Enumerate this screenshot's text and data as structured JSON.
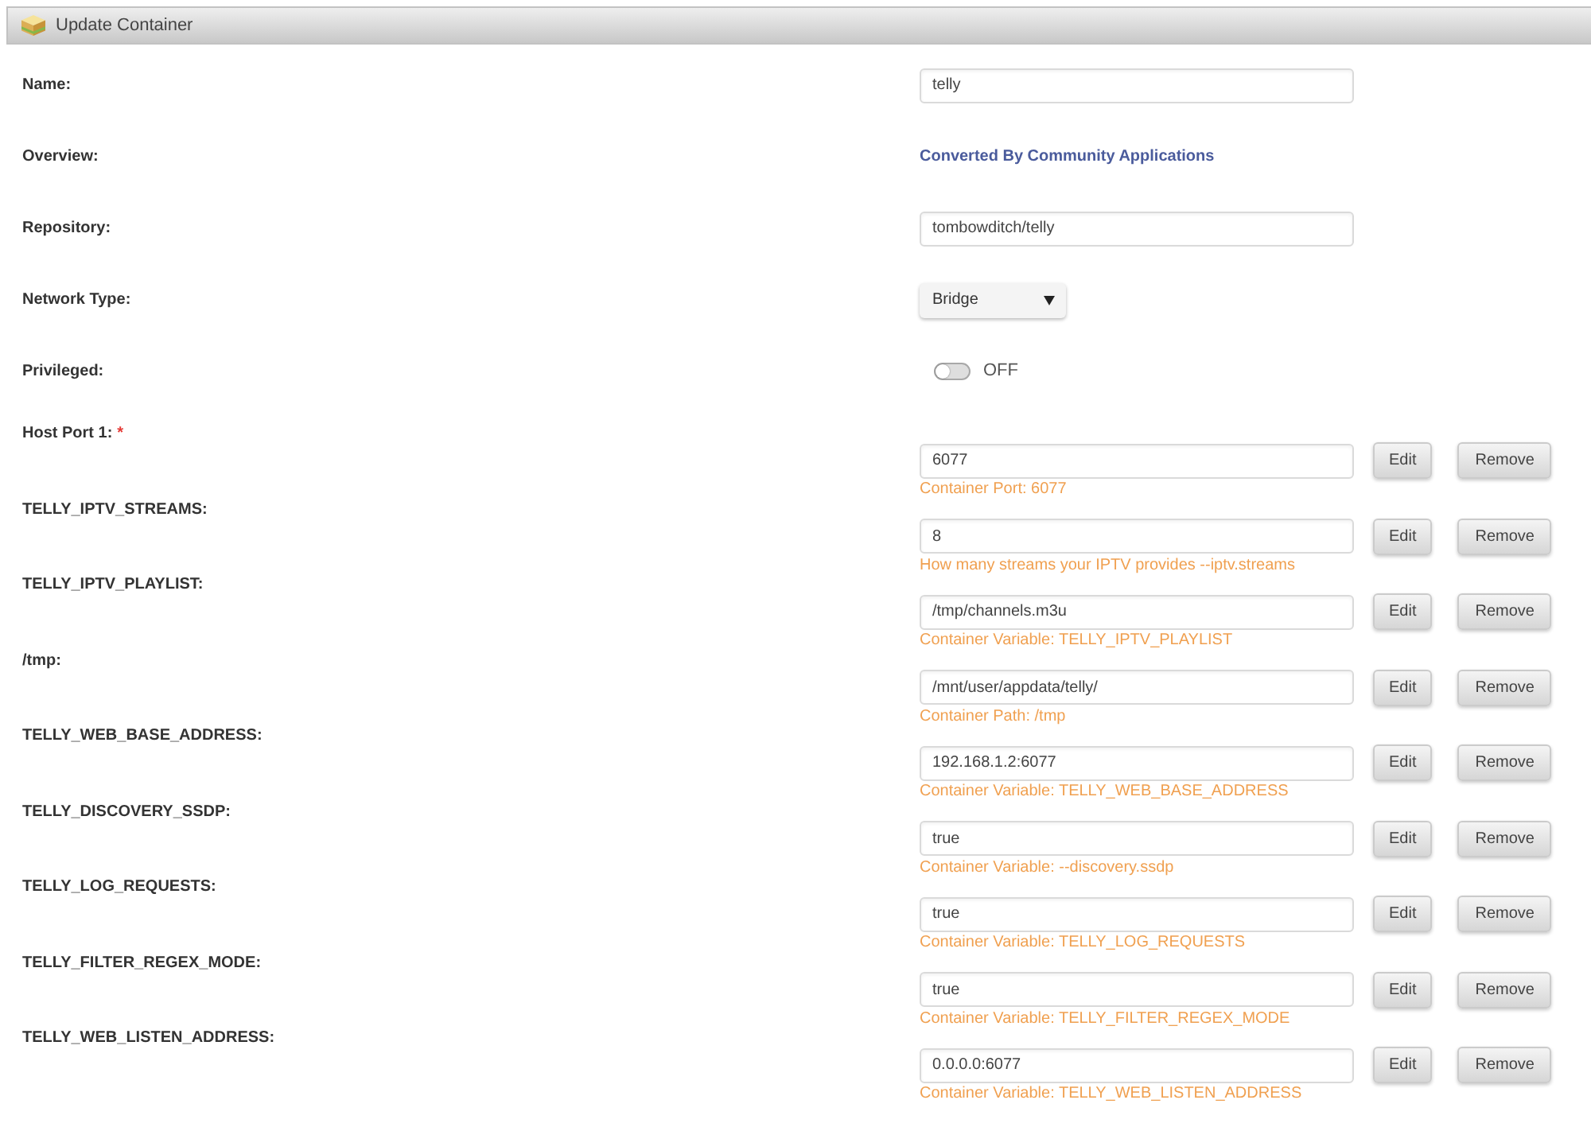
{
  "window": {
    "title": "Update Container"
  },
  "fields": [
    {
      "label": "Name:",
      "kind": "input",
      "value": "telly"
    },
    {
      "label": "Overview:",
      "kind": "text",
      "value": "Converted By Community Applications"
    },
    {
      "label": "Repository:",
      "kind": "input",
      "value": "tombowditch/telly"
    },
    {
      "label": "Network Type:",
      "kind": "select",
      "value": "Bridge"
    },
    {
      "label": "Privileged:",
      "kind": "toggle",
      "on": false,
      "state_text": "OFF"
    }
  ],
  "config": [
    {
      "label": "Host Port 1:",
      "required_mark": "*",
      "value": "6077",
      "description": "Container Port: 6077",
      "buttons": [
        "Edit",
        "Remove"
      ]
    },
    {
      "label": "TELLY_IPTV_STREAMS:",
      "value": "8",
      "description": "How many streams your IPTV provides --iptv.streams",
      "buttons": [
        "Edit",
        "Remove"
      ]
    },
    {
      "label": "TELLY_IPTV_PLAYLIST:",
      "value": "/tmp/channels.m3u",
      "description": "Container Variable: TELLY_IPTV_PLAYLIST",
      "buttons": [
        "Edit",
        "Remove"
      ]
    },
    {
      "label": "/tmp:",
      "value": "/mnt/user/appdata/telly/",
      "description": "Container Path: /tmp",
      "buttons": [
        "Edit",
        "Remove"
      ]
    },
    {
      "label": "TELLY_WEB_BASE_ADDRESS:",
      "value": "192.168.1.2:6077",
      "description": "Container Variable: TELLY_WEB_BASE_ADDRESS",
      "buttons": [
        "Edit",
        "Remove"
      ]
    },
    {
      "label": "TELLY_DISCOVERY_SSDP:",
      "value": "true",
      "description": "Container Variable: --discovery.ssdp",
      "buttons": [
        "Edit",
        "Remove"
      ]
    },
    {
      "label": "TELLY_LOG_REQUESTS:",
      "value": "true",
      "description": "Container Variable: TELLY_LOG_REQUESTS",
      "buttons": [
        "Edit",
        "Remove"
      ]
    },
    {
      "label": "TELLY_FILTER_REGEX_MODE:",
      "value": "true",
      "description": "Container Variable: TELLY_FILTER_REGEX_MODE",
      "buttons": [
        "Edit",
        "Remove"
      ]
    },
    {
      "label": "TELLY_WEB_LISTEN_ADDRESS:",
      "value": "0.0.0.0:6077",
      "description": "Container Variable: TELLY_WEB_LISTEN_ADDRESS",
      "buttons": [
        "Edit",
        "Remove"
      ]
    }
  ]
}
